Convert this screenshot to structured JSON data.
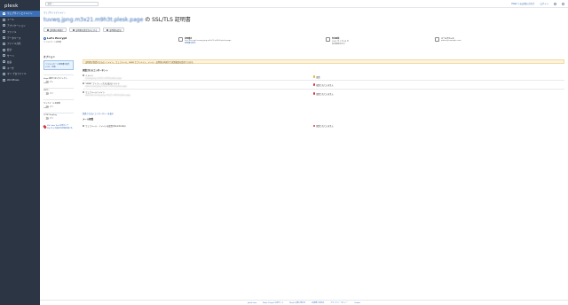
{
  "sidebar": {
    "brand": "plesk",
    "items": [
      {
        "label": "ウェブサイトとドメイン",
        "active": true
      },
      {
        "label": "メール"
      },
      {
        "label": "アプリケーション"
      },
      {
        "label": "ファイル"
      },
      {
        "label": "データベース"
      },
      {
        "label": "ファイル共有"
      },
      {
        "label": "統計"
      },
      {
        "label": "サーバ"
      },
      {
        "label": "拡張"
      },
      {
        "label": "ユーザ"
      },
      {
        "label": "マイ プロファイル"
      },
      {
        "label": "WordPress"
      }
    ]
  },
  "topbar": {
    "search_placeholder": "検索...",
    "links": [
      "Plesk へのお問い合わせ",
      "ログイン",
      "ダウンロード",
      "ヘルプ"
    ]
  },
  "main": {
    "breadcrumb": "ウェブサイトとドメイン",
    "title_domain": "tuvwq.jpng.m3x21.m9h3t.plesk.page",
    "title_suffix": "の SSL/TLS 証明書",
    "buttons": [
      "証明書の再発行",
      "証明書を認定済みとする",
      "証明書を追加"
    ],
    "card": {
      "title": "Let's Encrypt",
      "sub": "ワイルドカード証明書"
    },
    "options": {
      "heading": "オプション",
      "box_text": "ワイルドカード証明書を使うには…",
      "box_link": "詳細",
      "items": [
        {
          "label": "https 接続へのリダイレクト",
          "toggle": "オン"
        },
        {
          "label": "HSTS",
          "toggle": "オフ"
        },
        {
          "label": "ウェブメールを保護",
          "toggle": "オフ"
        },
        {
          "label": "OCSP Stapling",
          "toggle": "オフ"
        }
      ],
      "warning": "SSL Labs Test を実行して SSL/TLS の設定の評価を受ける"
    },
    "info": [
      {
        "label": "証明書名",
        "value": "Lets Encrypt tuvwq.jpng.m3x21.m9h3t.plesk.page",
        "link": "証明書を表示"
      },
      {
        "label": "有効期限",
        "value": "2022 年 2 月 28 日",
        "link": "有効期限の日付"
      },
      {
        "label": "メールアドレス",
        "value": "admin@example.com",
        "link": ""
      }
    ],
    "banner": "証明書が保護するもの: ドメイン、ウェブメール、www サブドメイン、メール – 証明書の再発行で保護範囲を変更できます。",
    "section1": "保護されるコンポーネント",
    "components": [
      {
        "name": "ドメイン",
        "sub": "tuvwq.jpng.m3x21.m9h3t.plesk.page",
        "status": "保護",
        "color": "#e3b92b"
      },
      {
        "name": "\"www\" プレフィックスのあるドメイン",
        "sub": "www.tuvwq.jpng.m3x21.m9h3t.plesk.page",
        "status": "保護されていません",
        "color": "#d9333f"
      },
      {
        "name": "ウェブメールドメイン",
        "sub": "webmail.tuvwq.jpng.m3x21.m9h3t.plesk.page",
        "status": "保護されていません",
        "color": "#d9333f"
      }
    ],
    "more_link": "保護されないコンポーネントを表示",
    "section2": "メール保護",
    "mail": {
      "name": "ウェブメール・ドメインを保護 (Roundcube)",
      "status": "保護されていません",
      "color": "#d9333f"
    }
  },
  "footer": {
    "links": [
      "plesk.com",
      "Plesk (Onyx) 公式サイト",
      "Plesk に問い合わせ",
      "お客様への対応",
      "プライバシーポリシー",
      "Cookie"
    ]
  }
}
